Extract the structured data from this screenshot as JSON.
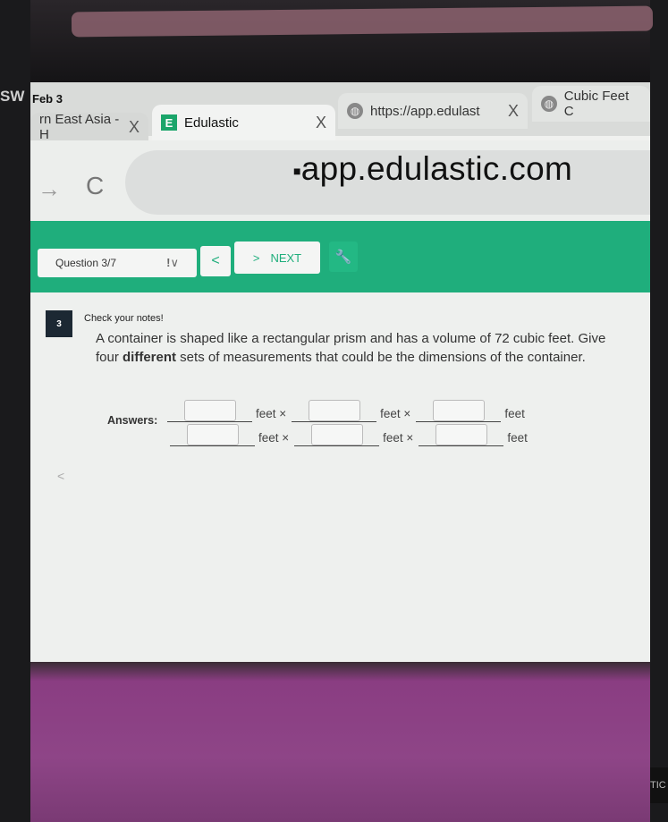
{
  "overlay": {
    "left_text": "SW",
    "right_text": "TIC"
  },
  "status_bar": {
    "date": "Feb 3"
  },
  "tabs": [
    {
      "label": "rn East Asia - H",
      "close": "X"
    },
    {
      "label": "Edulastic",
      "icon": "E",
      "close": "X",
      "active": true
    },
    {
      "label": "https://app.edulast",
      "close": "X"
    },
    {
      "label": "Cubic Feet C"
    }
  ],
  "browser": {
    "url": "app.edulastic.com",
    "forward": "→",
    "reload": "C"
  },
  "nav": {
    "question_select": "Question 3/7",
    "flag": "!",
    "chevron": "∨",
    "prev": "<",
    "next_arrow": ">",
    "next_label": "NEXT",
    "tools": "🔧"
  },
  "question": {
    "number": "3",
    "notes": "Check your notes!",
    "text_1": "A container is shaped like a rectangular prism and has a volume of 72 cubic feet. Give four ",
    "text_bold": "different",
    "text_2": " sets of measurements that could be the dimensions of the container.",
    "answers_label": "Answers:",
    "unit_times": "feet ×",
    "unit_last": "feet"
  },
  "side_arrow": "<",
  "colors": {
    "accent": "#1fae7c",
    "case": "#8e4587"
  }
}
